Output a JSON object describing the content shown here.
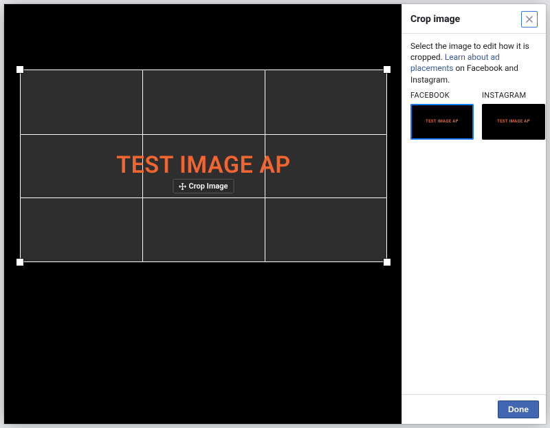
{
  "sidebar": {
    "title": "Crop image",
    "help_prefix": "Select the image to edit how it is cropped. ",
    "help_link_text": "Learn about ad placements",
    "help_suffix": " on Facebook and Instagram.",
    "done_label": "Done",
    "thumbs": [
      {
        "label": "FACEBOOK",
        "mini_text": "TEST IMAGE AP",
        "selected": true
      },
      {
        "label": "INSTAGRAM",
        "mini_text": "TEST IMAGE AP",
        "selected": false
      }
    ]
  },
  "stage": {
    "overlay_text": "TEST IMAGE AP",
    "crop_badge_label": "Crop Image"
  },
  "colors": {
    "accent_orange": "#f26430",
    "fb_blue": "#4267b2",
    "selection_blue": "#1877f2"
  }
}
